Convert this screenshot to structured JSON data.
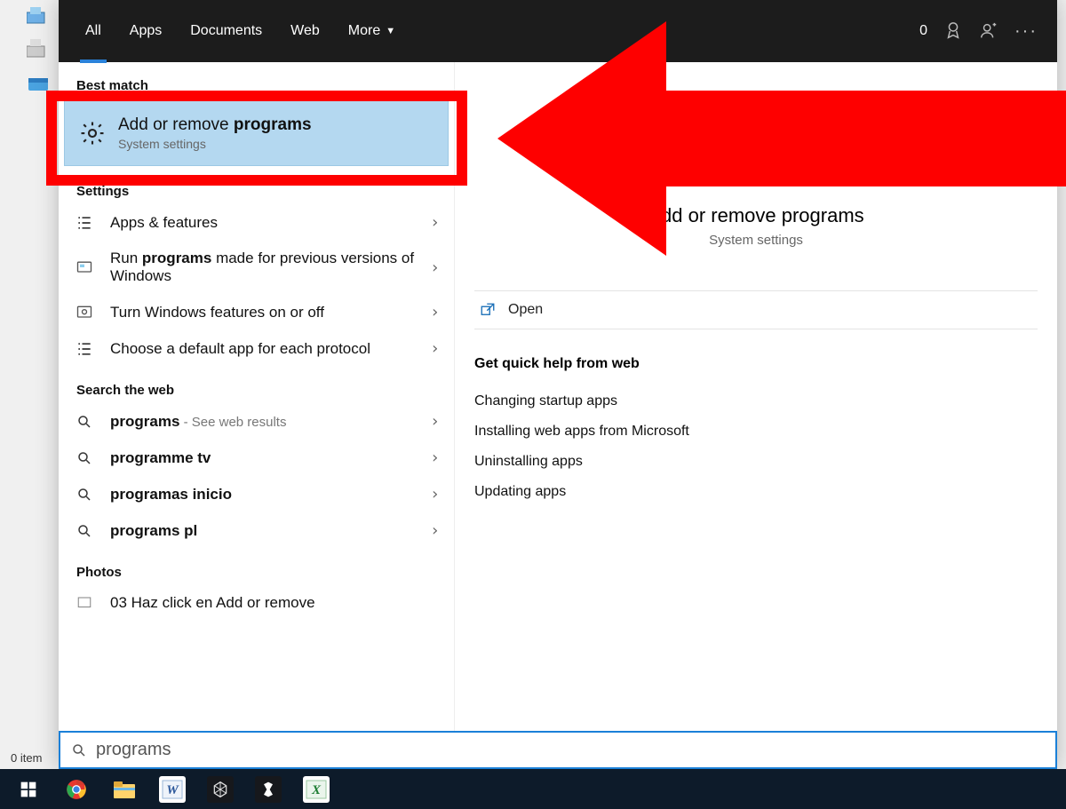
{
  "desktop": {
    "items_footer": "0 item"
  },
  "tabs": {
    "all": "All",
    "apps": "Apps",
    "documents": "Documents",
    "web": "Web",
    "more": "More",
    "badge": "0"
  },
  "sections": {
    "best_match": "Best match",
    "settings": "Settings",
    "search_web": "Search the web",
    "photos": "Photos"
  },
  "best": {
    "title_pre": "Add or remove ",
    "title_bold": "programs",
    "subtitle": "System settings"
  },
  "settings_results": [
    {
      "title": "Apps & features"
    },
    {
      "title_pre": "Run ",
      "title_bold": "programs",
      "title_post": " made for previous versions of Windows"
    },
    {
      "title": "Turn Windows features on or off"
    },
    {
      "title": "Choose a default app for each protocol"
    }
  ],
  "web_results": [
    {
      "bold": "programs",
      "suffix": " - See web results"
    },
    {
      "bold": "programme tv"
    },
    {
      "bold": "programas inicio"
    },
    {
      "bold": "programs pl"
    }
  ],
  "photos": [
    {
      "title": "03 Haz click en Add or remove"
    }
  ],
  "detail": {
    "title": "Add or remove programs",
    "subtitle": "System settings",
    "open": "Open",
    "help_header": "Get quick help from web",
    "help_links": [
      "Changing startup apps",
      "Installing web apps from Microsoft",
      "Uninstalling apps",
      "Updating apps"
    ]
  },
  "search": {
    "value": "programs"
  }
}
